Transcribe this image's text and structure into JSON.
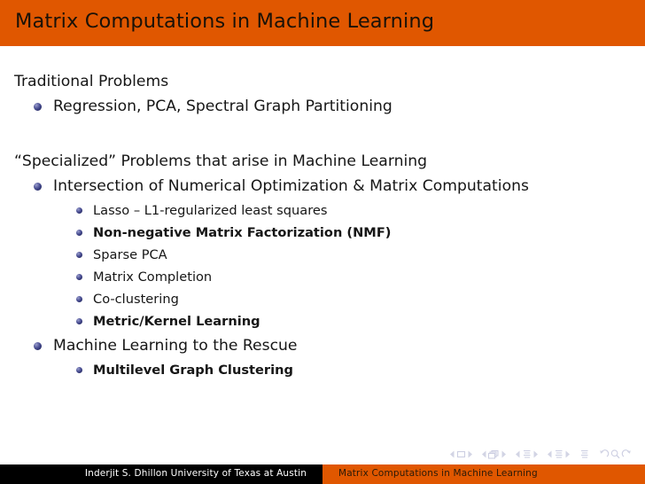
{
  "slide": {
    "title": "Matrix Computations in Machine Learning",
    "colors": {
      "title_bar_bg": "#e05700",
      "title_text": "#1a1208",
      "body_bg": "#ffffff",
      "body_text": "#161616",
      "bullet": "#2b2f6b",
      "footer_left_bg": "#000000",
      "footer_left_text": "#ffffff",
      "footer_right_bg": "#e05700",
      "footer_right_text": "#2a1a08",
      "nav_symbol": "#ced0e2"
    },
    "blocks": [
      {
        "heading": "Traditional Problems",
        "items": [
          {
            "level": 1,
            "text": "Regression, PCA, Spectral Graph Partitioning",
            "bold": false
          }
        ]
      },
      {
        "heading": "“Specialized” Problems that arise in Machine Learning",
        "items": [
          {
            "level": 1,
            "text": "Intersection of Numerical Optimization & Matrix Computations",
            "bold": false
          },
          {
            "level": 2,
            "text": "Lasso – L1-regularized least squares",
            "bold": false
          },
          {
            "level": 2,
            "text": "Non-negative Matrix Factorization (NMF)",
            "bold": true
          },
          {
            "level": 2,
            "text": "Sparse PCA",
            "bold": false
          },
          {
            "level": 2,
            "text": "Matrix Completion",
            "bold": false
          },
          {
            "level": 2,
            "text": "Co-clustering",
            "bold": false
          },
          {
            "level": 2,
            "text": "Metric/Kernel Learning",
            "bold": true
          },
          {
            "level": 1,
            "text": "Machine Learning to the Rescue",
            "bold": false
          },
          {
            "level": 2,
            "text": "Multilevel Graph Clustering",
            "bold": true
          }
        ]
      }
    ]
  },
  "nav": {
    "symbols": [
      {
        "name": "slide-navigation",
        "icon": "square-icon"
      },
      {
        "name": "frame-navigation",
        "icon": "frames-icon"
      },
      {
        "name": "subsection-navigation",
        "icon": "lines-icon"
      },
      {
        "name": "section-navigation",
        "icon": "lines-icon"
      },
      {
        "name": "presentation-navigation",
        "icon": "lines-icon"
      },
      {
        "name": "back-search-forward",
        "icon": "search-arrows-icon"
      }
    ]
  },
  "footer": {
    "left": "Inderjit S. Dhillon  University of Texas at Austin",
    "right": "Matrix Computations in Machine Learning"
  }
}
